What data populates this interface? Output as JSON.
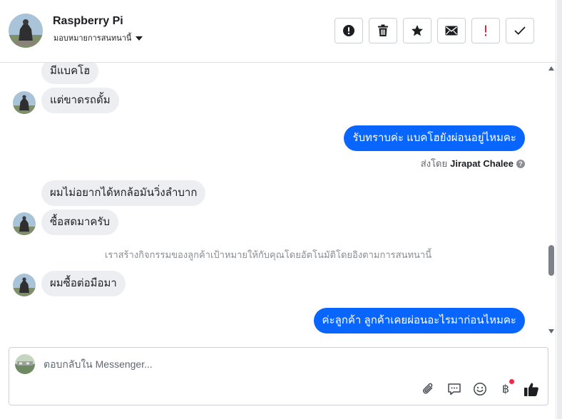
{
  "header": {
    "title": "Raspberry Pi",
    "assign_label": "มอบหมายการสนทนานี้"
  },
  "actions": [
    {
      "name": "spam-alert",
      "icon": "exclamation-circle-icon"
    },
    {
      "name": "delete",
      "icon": "trash-icon"
    },
    {
      "name": "star",
      "icon": "star-icon"
    },
    {
      "name": "mark-unread",
      "icon": "envelope-icon"
    },
    {
      "name": "follow-up",
      "icon": "exclamation-icon"
    },
    {
      "name": "done",
      "icon": "check-icon"
    }
  ],
  "messages": [
    {
      "side": "in",
      "text": "มีแบคโฮ"
    },
    {
      "side": "in",
      "text": "แต่ขาดรถดั้ม"
    },
    {
      "side": "out",
      "text": "รับทราบค่ะ แบคโฮยังผ่อนอยู่ไหมคะ"
    },
    {
      "side": "in",
      "text": "ผมไม่อยากได้หกล้อมันวิ่งลำบาก"
    },
    {
      "side": "in",
      "text": "ซื้อสดมาครับ"
    },
    {
      "side": "in",
      "text": "ผมซื้อต่อมือมา"
    },
    {
      "side": "out",
      "text": "ค่ะลูกค้า ลูกค้าเคยผ่อนอะไรมาก่อนไหมคะ"
    }
  ],
  "sent_by": {
    "prefix": "ส่งโดย",
    "name": "Jirapat Chalee",
    "help": "?"
  },
  "system_note": "เราสร้างกิจกรรมของลูกค้าเป้าหมายให้กับคุณโดยอัตโนมัติโดยอิงตามการสนทนานี้",
  "composer": {
    "placeholder": "ตอบกลับใน Messenger...",
    "value": "",
    "baht_symbol": "฿"
  },
  "colors": {
    "outgoing": "#0866ff",
    "incoming": "#eceef1",
    "notification_dot": "#f02849"
  }
}
